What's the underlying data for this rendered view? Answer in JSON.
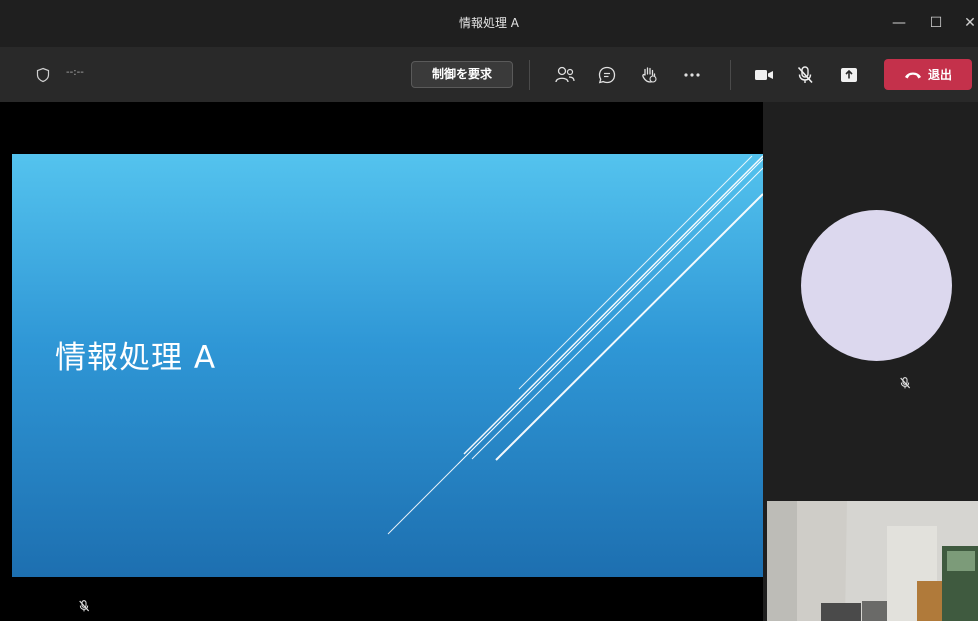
{
  "window": {
    "title": "情報処理 A",
    "minimize_glyph": "—",
    "maximize_glyph": "☐",
    "close_glyph": "✕"
  },
  "toolbar": {
    "timer": "--:--",
    "request_control_label": "制御を要求",
    "leave_label": "退出",
    "icons": [
      "shield-icon",
      "participants-icon",
      "chat-icon",
      "raise-hand-icon",
      "more-icon",
      "camera-icon",
      "mic-off-icon",
      "share-icon",
      "hangup-icon"
    ]
  },
  "slide": {
    "title": "情報処理 A"
  },
  "colors": {
    "leave_button": "#c4314b",
    "toolbar": "#292929",
    "titlebar": "#1f1f1f",
    "avatar": "#dcd8ee"
  }
}
